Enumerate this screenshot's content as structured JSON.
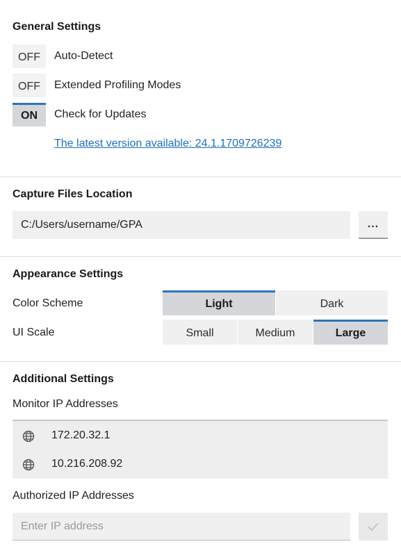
{
  "general": {
    "title": "General Settings",
    "toggles": [
      {
        "state": "OFF",
        "label": "Auto-Detect"
      },
      {
        "state": "OFF",
        "label": "Extended Profiling Modes"
      },
      {
        "state": "ON",
        "label": "Check for Updates"
      }
    ],
    "update_link": "The latest version available: 24.1.1709726239"
  },
  "capture": {
    "title": "Capture Files Location",
    "path": "C:/Users/username/GPA",
    "browse_label": "..."
  },
  "appearance": {
    "title": "Appearance Settings",
    "color_scheme_label": "Color Scheme",
    "color_scheme_options": [
      "Light",
      "Dark"
    ],
    "color_scheme_selected": "Light",
    "ui_scale_label": "UI Scale",
    "ui_scale_options": [
      "Small",
      "Medium",
      "Large"
    ],
    "ui_scale_selected": "Large"
  },
  "additional": {
    "title": "Additional Settings",
    "monitor_label": "Monitor IP Addresses",
    "monitor_ips": [
      "172.20.32.1",
      "10.216.208.92"
    ],
    "authorized_label": "Authorized IP Addresses",
    "ip_placeholder": "Enter IP address"
  },
  "colors": {
    "accent": "#2f73b8",
    "link": "#1f6fbd",
    "selected_bg": "#d4d6d9"
  }
}
